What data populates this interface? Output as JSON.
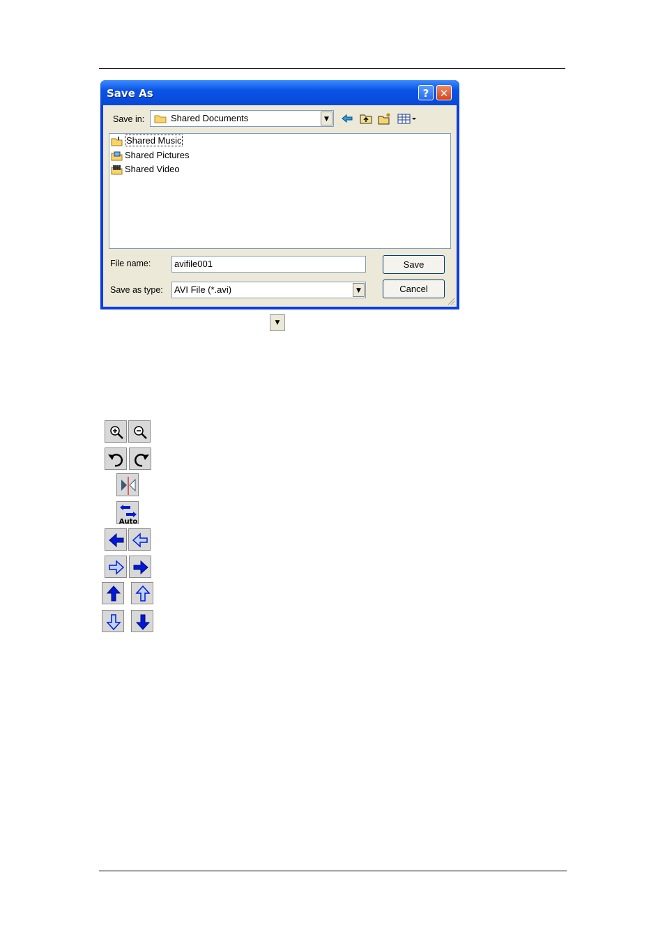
{
  "dialog": {
    "title": "Save As",
    "help_glyph": "?",
    "close_glyph": "✕",
    "save_in_label": "Save in:",
    "save_in_value": "Shared Documents",
    "files": [
      {
        "name": "Shared Music",
        "icon": "music-folder-icon"
      },
      {
        "name": "Shared Pictures",
        "icon": "pictures-folder-icon"
      },
      {
        "name": "Shared Video",
        "icon": "video-folder-icon"
      }
    ],
    "file_name_label": "File name:",
    "file_name_value": "avifile001",
    "save_type_label": "Save as type:",
    "save_type_value": "AVI File (*.avi)",
    "save_label": "Save",
    "cancel_label": "Cancel"
  },
  "icons": [
    "zoom-in-icon",
    "zoom-out-icon",
    "rotate-left-icon",
    "rotate-right-icon",
    "mirror-icon",
    "auto-icon",
    "arrow-left-solid-icon",
    "arrow-left-outline-icon",
    "arrow-right-outline-icon",
    "arrow-right-solid-icon",
    "arrow-up-solid-icon",
    "arrow-up-outline-icon",
    "arrow-down-outline-icon",
    "arrow-down-solid-icon"
  ],
  "auto_label": "Auto",
  "colors": {
    "title_blue": "#0a54e6",
    "arrow_blue": "#0018d8",
    "arrow_light": "#bcd4ff"
  }
}
